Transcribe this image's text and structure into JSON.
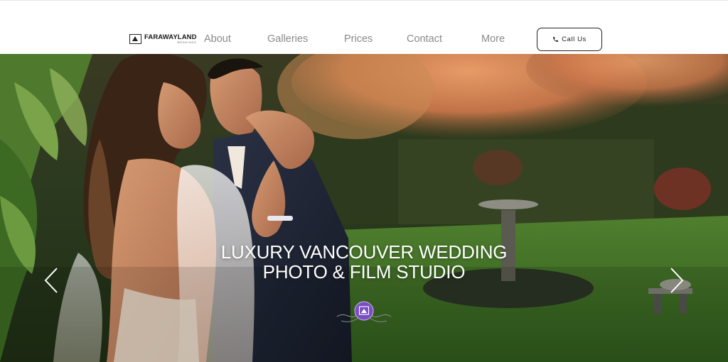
{
  "header": {
    "logo": {
      "name": "FARAWAYLAND",
      "sub": "WEDDINGS"
    },
    "nav": [
      {
        "label": "About"
      },
      {
        "label": "Galleries"
      },
      {
        "label": "Prices"
      },
      {
        "label": "Contact"
      },
      {
        "label": "More"
      }
    ],
    "cta": {
      "label": "Call Us",
      "icon": "phone-icon"
    }
  },
  "hero": {
    "title_line1": "LUXURY VANCOUVER WEDDING",
    "title_line2": "PHOTO & FILM STUDIO",
    "prev_icon": "chevron-left-icon",
    "next_icon": "chevron-right-icon",
    "badge_icon": "farawayland-badge-icon",
    "badge_color": "#7b4fc2"
  },
  "colors": {
    "nav_text": "#8a8a8a",
    "button_border": "#222222",
    "hero_title": "#ffffff"
  }
}
